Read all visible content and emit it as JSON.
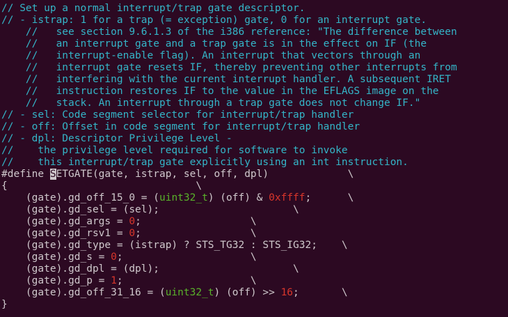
{
  "editor": {
    "cursor_char": "S",
    "lines": [
      {
        "kind": "comment",
        "text": "// Set up a normal interrupt/trap gate descriptor."
      },
      {
        "kind": "comment",
        "text": "// - istrap: 1 for a trap (= exception) gate, 0 for an interrupt gate."
      },
      {
        "kind": "comment",
        "text": "    //   see section 9.6.1.3 of the i386 reference: \"The difference between"
      },
      {
        "kind": "comment",
        "text": "    //   an interrupt gate and a trap gate is in the effect on IF (the"
      },
      {
        "kind": "comment",
        "text": "    //   interrupt-enable flag). An interrupt that vectors through an"
      },
      {
        "kind": "comment",
        "text": "    //   interrupt gate resets IF, thereby preventing other interrupts from"
      },
      {
        "kind": "comment",
        "text": "    //   interfering with the current interrupt handler. A subsequent IRET"
      },
      {
        "kind": "comment",
        "text": "    //   instruction restores IF to the value in the EFLAGS image on the"
      },
      {
        "kind": "comment",
        "text": "    //   stack. An interrupt through a trap gate does not change IF.\""
      },
      {
        "kind": "comment",
        "text": "// - sel: Code segment selector for interrupt/trap handler"
      },
      {
        "kind": "comment",
        "text": "// - off: Offset in code segment for interrupt/trap handler"
      },
      {
        "kind": "comment",
        "text": "// - dpl: Descriptor Privilege Level -"
      },
      {
        "kind": "comment",
        "text": "//    the privilege level required for software to invoke"
      },
      {
        "kind": "comment",
        "text": "//    this interrupt/trap gate explicitly using an int instruction."
      }
    ],
    "define": {
      "prefix": "#define ",
      "cursor": "S",
      "rest": "ETGATE(gate, istrap, sel, off, dpl)             \\"
    },
    "brace_open": "{                               \\",
    "body": [
      {
        "a": "    (gate).gd_off_15_0 = (",
        "type": "uint32_t",
        "b": ") (off) & ",
        "num": "0xffff",
        "c": ";      \\"
      },
      {
        "a": "    (gate).gd_sel = (sel);                      \\"
      },
      {
        "a": "    (gate).gd_args = ",
        "num": "0",
        "c": ";                  \\"
      },
      {
        "a": "    (gate).gd_rsv1 = ",
        "num": "0",
        "c": ";                  \\"
      },
      {
        "a": "    (gate).gd_type = (istrap) ? STS_TG32 : STS_IG32;    \\"
      },
      {
        "a": "    (gate).gd_s = ",
        "num": "0",
        "c": ";                     \\"
      },
      {
        "a": "    (gate).gd_dpl = (dpl);                      \\"
      },
      {
        "a": "    (gate).gd_p = ",
        "num": "1",
        "c": ";                     \\"
      },
      {
        "a": "    (gate).gd_off_31_16 = (",
        "type": "uint32_t",
        "b": ") (off) >> ",
        "num": "16",
        "c": ";       \\"
      }
    ],
    "brace_close": "}"
  }
}
